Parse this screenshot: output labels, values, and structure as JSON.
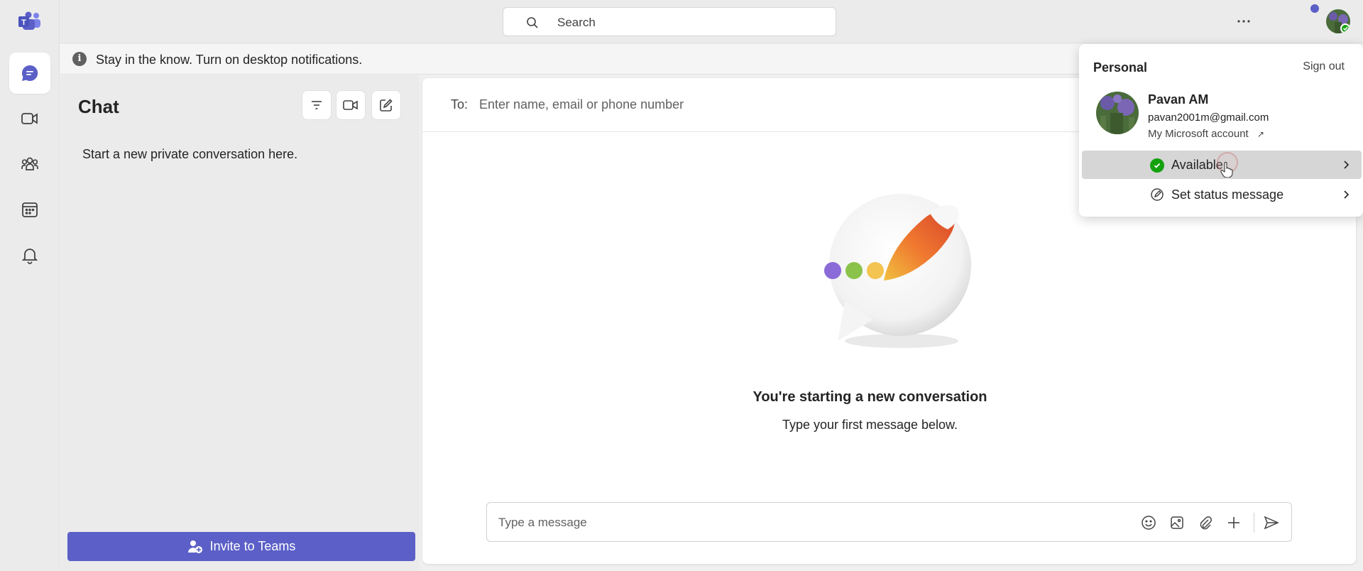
{
  "app": {
    "name": "Microsoft Teams"
  },
  "rail": {
    "items": [
      {
        "id": "chat",
        "icon": "chat-icon",
        "active": true
      },
      {
        "id": "meet",
        "icon": "video-icon",
        "active": false
      },
      {
        "id": "communities",
        "icon": "people-icon",
        "active": false
      },
      {
        "id": "calendar",
        "icon": "calendar-icon",
        "active": false
      },
      {
        "id": "activity",
        "icon": "bell-icon",
        "active": false
      }
    ]
  },
  "topbar": {
    "search_placeholder": "Search",
    "more_icon": "more-icon"
  },
  "banner": {
    "text": "Stay in the know. Turn on desktop notifications.",
    "info_glyph": "i"
  },
  "chat_pane": {
    "title": "Chat",
    "hint": "Start a new private conversation here.",
    "invite_label": "Invite to Teams"
  },
  "conversation": {
    "to_label": "To:",
    "to_placeholder": "Enter name, email or phone number",
    "empty_title": "You're starting a new conversation",
    "empty_subtitle": "Type your first message below.",
    "composer_placeholder": "Type a message"
  },
  "profile_menu": {
    "section_label": "Personal",
    "sign_out_label": "Sign out",
    "name": "Pavan AM",
    "email": "pavan2001m@gmail.com",
    "account_link": "My Microsoft account",
    "status_label": "Available",
    "status_message_label": "Set status message"
  },
  "colors": {
    "brand": "#5b5fc7",
    "available": "#13a10e"
  }
}
